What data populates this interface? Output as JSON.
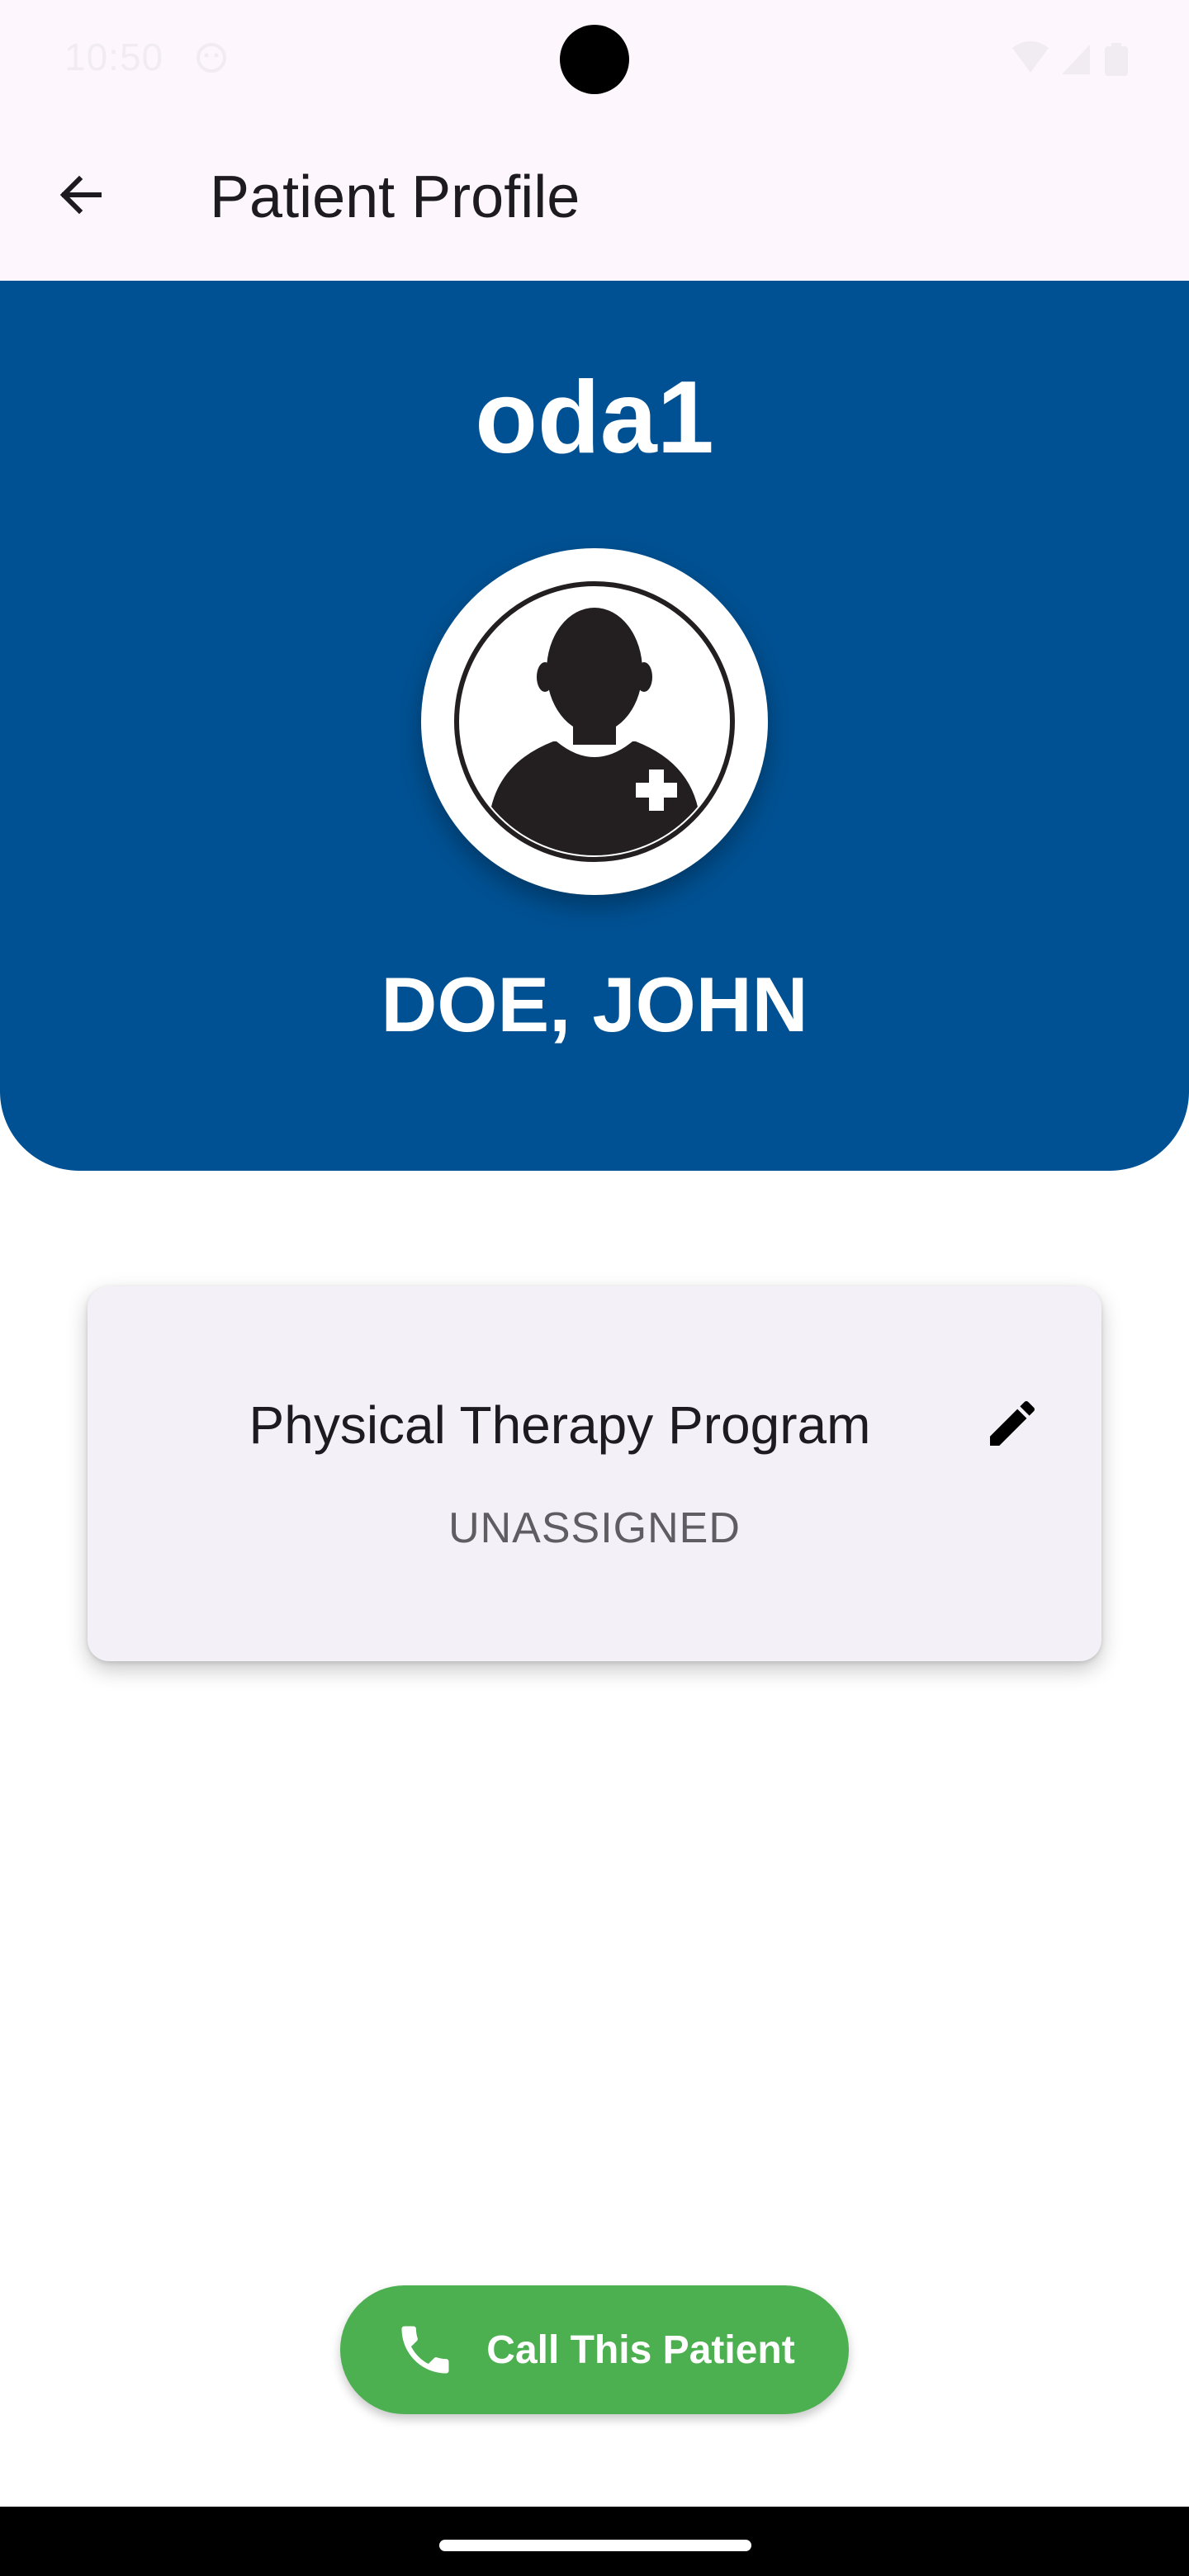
{
  "status_bar": {
    "time": "10:50",
    "left_icon": "face-icon",
    "right_icons": [
      "wifi-icon",
      "signal-icon",
      "battery-icon"
    ]
  },
  "app_bar": {
    "back_icon": "arrow-left-icon",
    "title": "Patient Profile"
  },
  "header": {
    "patient_id": "oda1",
    "avatar_icon": "patient-avatar-icon",
    "patient_name": "DOE, JOHN",
    "background_color": "#005193"
  },
  "program_card": {
    "title": "Physical Therapy Program",
    "status": "UNASSIGNED",
    "edit_icon": "pencil-icon"
  },
  "call_button": {
    "label": "Call This Patient",
    "icon": "phone-icon",
    "color": "#4caf50"
  }
}
